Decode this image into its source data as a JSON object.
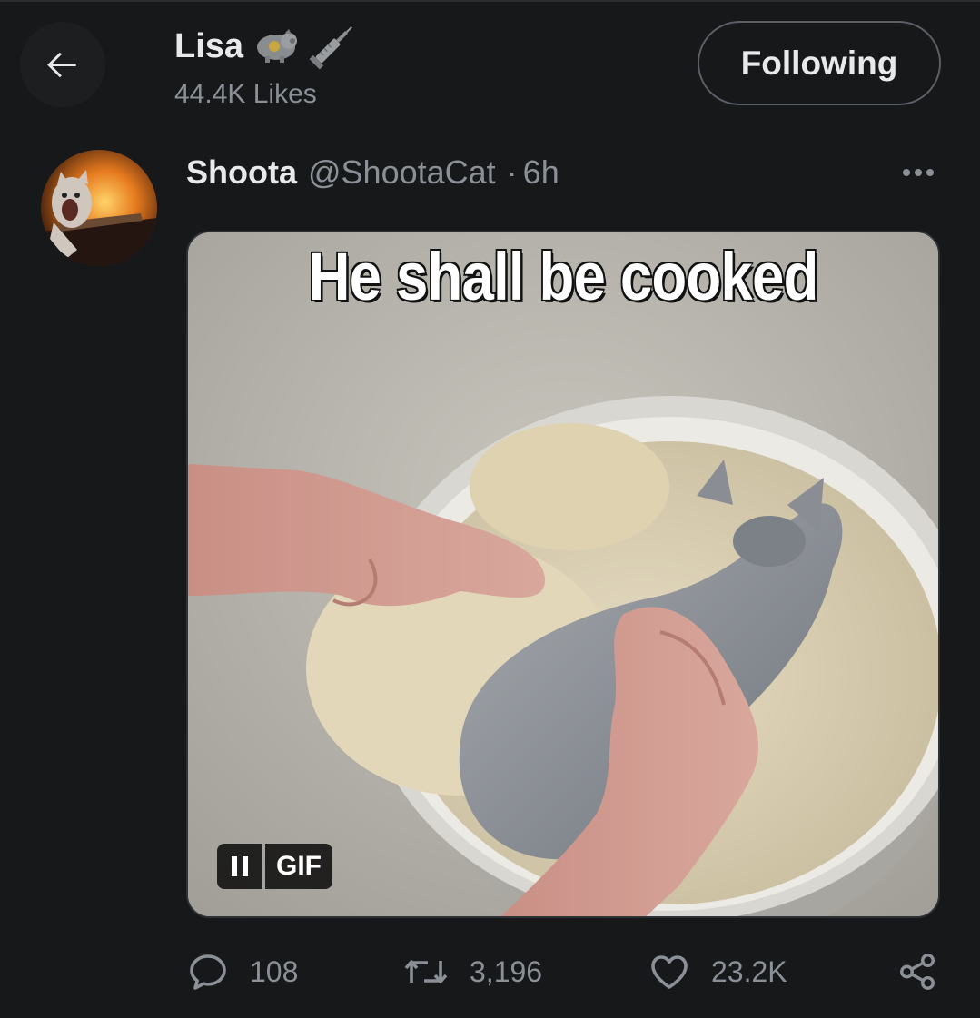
{
  "header": {
    "back_icon": "arrow-left-icon",
    "profile_name": "Lisa",
    "name_emojis": [
      "pig-emoji",
      "syringe-emoji"
    ],
    "likes_count": "44.4K Likes",
    "follow_button_label": "Following"
  },
  "tweet": {
    "author_name": "Shoota",
    "author_handle": "@ShootaCat",
    "separator": "·",
    "time": "6h",
    "more_icon": "more-dots-icon",
    "media": {
      "caption": "He shall be cooked",
      "gif_badge": "GIF",
      "pause_icon": "pause-icon"
    },
    "actions": {
      "replies": "108",
      "retweets": "3,196",
      "likes": "23.2K",
      "reply_icon": "reply-icon",
      "retweet_icon": "retweet-icon",
      "like_icon": "heart-icon",
      "share_icon": "share-icon"
    }
  },
  "colors": {
    "background": "#16181a",
    "primary_text": "#e7e9ea",
    "secondary_text": "#8b9096"
  }
}
